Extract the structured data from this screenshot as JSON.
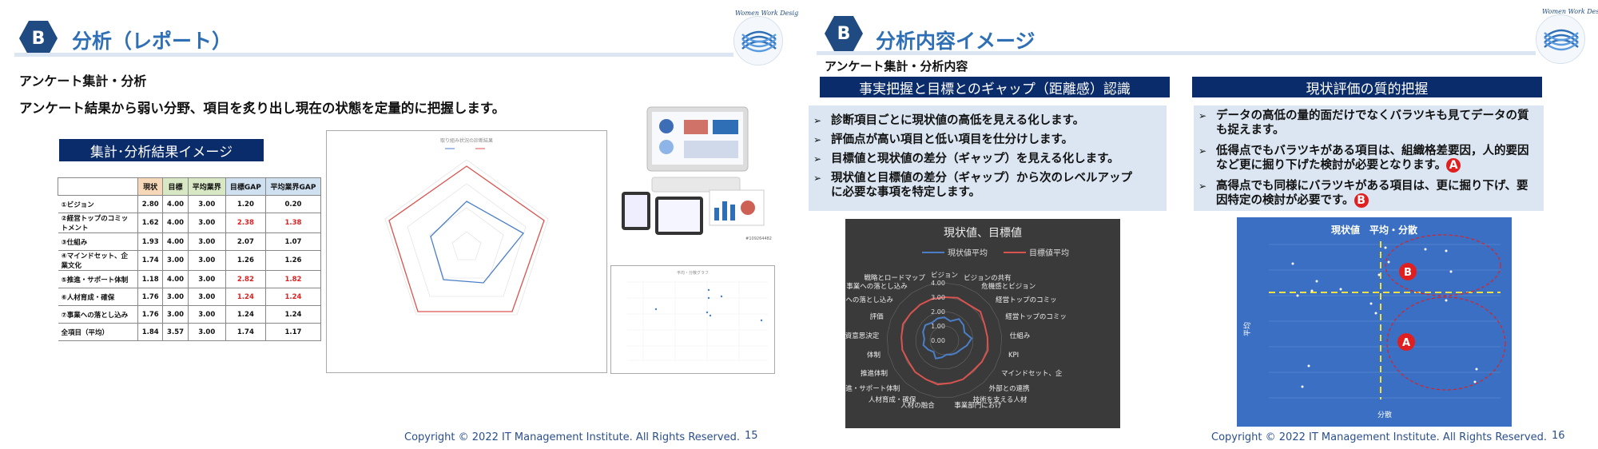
{
  "left": {
    "badge": "B",
    "title": "分析（レポート）",
    "logo_text": "Women Work Design",
    "subtitle": "アンケート集計・分析",
    "description": "アンケート結果から弱い分野、項目を炙り出し現在の状態を定量的に把握します。",
    "result_box": "集計･分析結果イメージ",
    "table": {
      "headers": [
        "",
        "現状",
        "目標",
        "平均業界",
        "目標GAP",
        "平均業界GAP"
      ],
      "rows": [
        {
          "label": "①ビジョン",
          "values": [
            "2.80",
            "4.00",
            "3.00",
            "1.20",
            "0.20"
          ],
          "red": [
            false,
            false
          ]
        },
        {
          "label": "②経営トップのコミットメント",
          "values": [
            "1.62",
            "4.00",
            "3.00",
            "2.38",
            "1.38"
          ],
          "red": [
            true,
            true
          ]
        },
        {
          "label": "③仕組み",
          "values": [
            "1.93",
            "4.00",
            "3.00",
            "2.07",
            "1.07"
          ],
          "red": [
            false,
            false
          ]
        },
        {
          "label": "④マインドセット、企業文化",
          "values": [
            "1.74",
            "3.00",
            "3.00",
            "1.26",
            "1.26"
          ],
          "red": [
            false,
            false
          ]
        },
        {
          "label": "⑤推進・サポート体制",
          "values": [
            "1.18",
            "4.00",
            "3.00",
            "2.82",
            "1.82"
          ],
          "red": [
            true,
            true
          ]
        },
        {
          "label": "⑥人材育成・確保",
          "values": [
            "1.76",
            "3.00",
            "3.00",
            "1.24",
            "1.24"
          ],
          "red": [
            true,
            true
          ]
        },
        {
          "label": "⑦事業への落とし込み",
          "values": [
            "1.76",
            "3.00",
            "3.00",
            "1.24",
            "1.24"
          ],
          "red": [
            false,
            false
          ]
        },
        {
          "label": "全項目（平均）",
          "values": [
            "1.84",
            "3.57",
            "3.00",
            "1.74",
            "1.17"
          ],
          "red": [
            false,
            false
          ]
        }
      ]
    },
    "footer": "Copyright © 2022 IT Management Institute. All Rights Reserved.",
    "page_number": "15"
  },
  "right": {
    "badge": "B",
    "title": "分析内容イメージ",
    "logo_text": "Women Work Design",
    "subtitle": "アンケート集計・分析内容",
    "box1_title": "事実把握と目標とのギャップ（距離感）認識",
    "box1_bullets": [
      "診断項目ごとに現状値の高低を見える化します。",
      "評価点が高い項目と低い項目を仕分けします。",
      "目標値と現状値の差分（ギャップ）を見える化します。",
      "現状値と目標値の差分（ギャップ）から次のレベルアップに必要な事項を特定します。"
    ],
    "box2_title": "現状評価の質的把握",
    "box2_bullets": [
      {
        "text": "データの高低の量的面だけでなくバラツキも見てデータの質も捉えます。",
        "mark": ""
      },
      {
        "text": "低得点でもバラツキがある項目は、組織格差要因，人的要因など更に掘り下げた検討が必要となります。",
        "mark": "A"
      },
      {
        "text": "高得点でも同様にバラツキがある項目は、更に掘り下げ、要因特定の検討が必要です。",
        "mark": "B"
      }
    ],
    "footer": "Copyright © 2022 IT Management Institute. All Rights Reserved.",
    "page_number": "16"
  },
  "chart_data": [
    {
      "type": "radar",
      "title": "現状値、目標値",
      "series": [
        {
          "name": "現状値平均",
          "color": "#4a7fc8"
        },
        {
          "name": "目標値平均",
          "color": "#d9534f"
        }
      ],
      "categories": [
        "ビジョン",
        "ビジョンの共有",
        "危機感とビジョン",
        "経営トップのコミッ",
        "経営トップのコミッ",
        "仕組み",
        "KPI",
        "マインドセット、企",
        "外部との連携",
        "技術を支える人材",
        "事業部門におけ",
        "人材の融合",
        "人材育成・確保",
        "推進・サポート体制",
        "推進体制",
        "体制",
        "投資意思決定",
        "評価",
        "事業への落とし込み",
        "事業への落とし込み",
        "戦略とロードマップ"
      ],
      "ticks": [
        "0.00",
        "1.00",
        "2.00",
        "3.00",
        "4.00"
      ],
      "colors": {
        "background": "#3a3a3a"
      }
    },
    {
      "type": "scatter",
      "title": "現状値　平均・分散",
      "xlabel": "分散",
      "ylabel": "平均",
      "annotations": [
        "A",
        "B"
      ],
      "colors": {
        "background": "#3a6fc4",
        "quadrant_line": "#f0e040",
        "circle": "#e02020"
      }
    }
  ]
}
